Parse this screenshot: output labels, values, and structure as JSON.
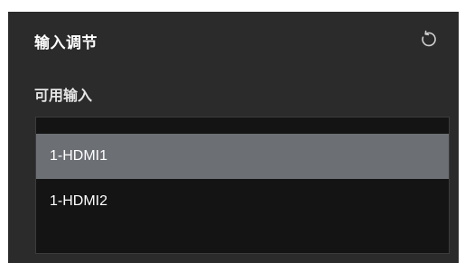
{
  "panel": {
    "title": "输入调节",
    "reset_icon": "reset-icon",
    "subtitle": "可用输入"
  },
  "inputs": {
    "items": [
      {
        "label": "1-HDMI1",
        "selected": true
      },
      {
        "label": "1-HDMI2",
        "selected": false
      }
    ]
  },
  "colors": {
    "panel_bg": "#2b2b2b",
    "list_bg": "#141414",
    "selected_bg": "#6c6f74",
    "text": "#ffffff"
  }
}
